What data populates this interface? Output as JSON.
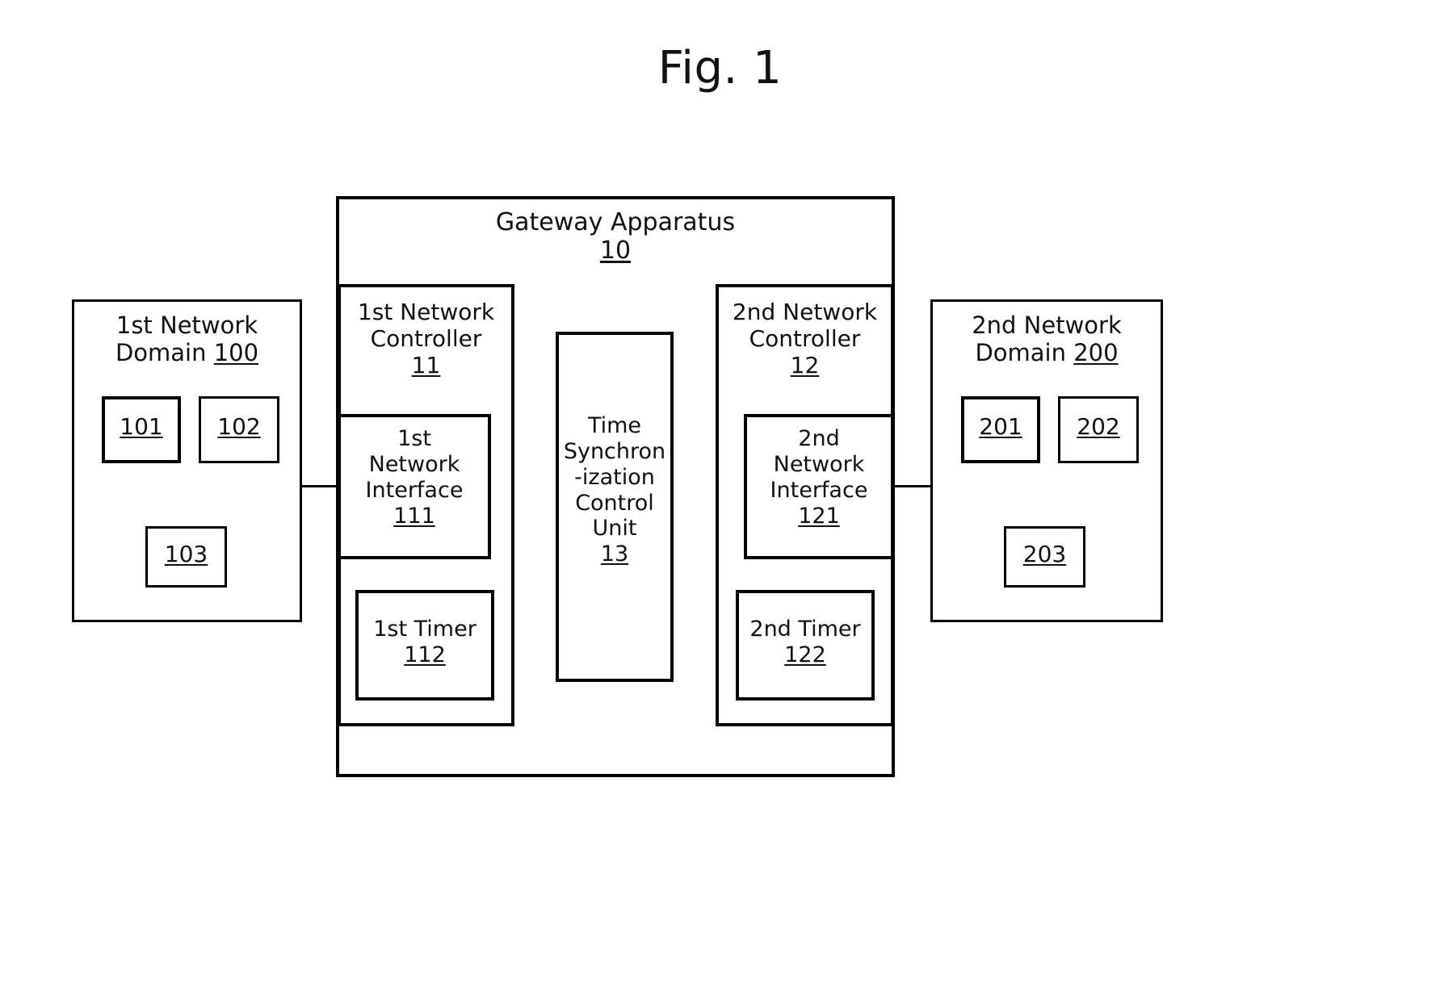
{
  "figure": {
    "title": "Fig. 1"
  },
  "gateway": {
    "name": "Gateway Apparatus",
    "ref": "10"
  },
  "domain1": {
    "name_line1": "1st Network",
    "name_line2": "Domain",
    "ref": "100",
    "nodes": [
      {
        "ref": "101"
      },
      {
        "ref": "102"
      },
      {
        "ref": "103"
      }
    ]
  },
  "domain2": {
    "name_line1": "2nd Network",
    "name_line2": "Domain",
    "ref": "200",
    "nodes": [
      {
        "ref": "201"
      },
      {
        "ref": "202"
      },
      {
        "ref": "203"
      }
    ]
  },
  "controller1": {
    "name_line1": "1st Network",
    "name_line2": "Controller",
    "ref": "11",
    "interface": {
      "name_line1": "1st",
      "name_line2": "Network",
      "name_line3": "Interface",
      "ref": "111"
    },
    "timer": {
      "name": "1st Timer",
      "ref": "112"
    }
  },
  "controller2": {
    "name_line1": "2nd Network",
    "name_line2": "Controller",
    "ref": "12",
    "interface": {
      "name_line1": "2nd",
      "name_line2": "Network",
      "name_line3": "Interface",
      "ref": "121"
    },
    "timer": {
      "name": "2nd Timer",
      "ref": "122"
    }
  },
  "time_sync": {
    "name_line1": "Time",
    "name_line2": "Synchron",
    "name_line3": "-ization",
    "name_line4": "Control",
    "name_line5": "Unit",
    "ref": "13"
  },
  "colors": {
    "stroke": "#000000",
    "background": "#ffffff",
    "text": "#111111"
  }
}
